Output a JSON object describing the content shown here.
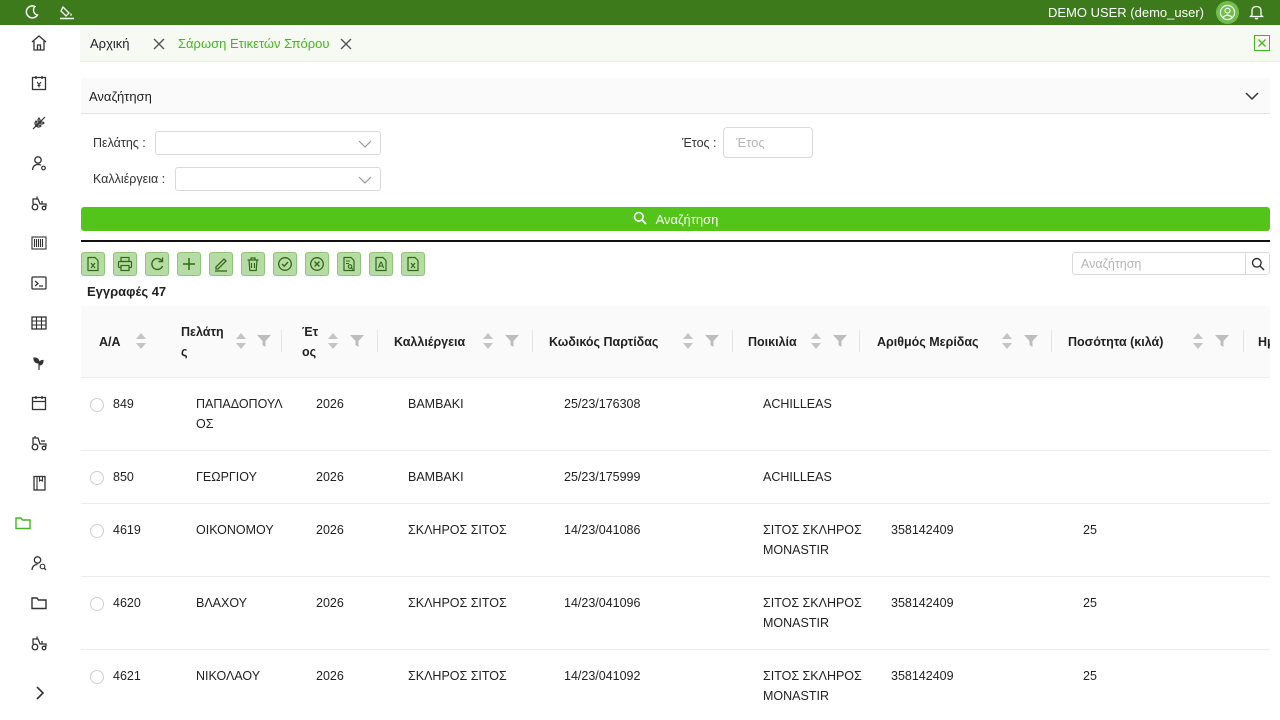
{
  "topbar": {
    "user_name": "DEMO USER (demo_user)"
  },
  "tabs": [
    {
      "label": "Αρχική"
    },
    {
      "label": "Σάρωση Ετικετών Σπόρου"
    }
  ],
  "search_panel": {
    "title": "Αναζήτηση",
    "customer_label": "Πελάτης :",
    "crop_label": "Καλλιέργεια :",
    "year_label": "Έτος :",
    "year_placeholder": "Έτος",
    "search_button": "Αναζήτηση"
  },
  "grid": {
    "search_placeholder": "Αναζήτηση",
    "records_label": "Εγγραφές 47",
    "columns": {
      "aa": "Α/Α",
      "customer_a": "Πελάτη",
      "customer_b": "ς",
      "year_a": "Έτ",
      "year_b": "ος",
      "crop": "Καλλιέργεια",
      "batch": "Κωδικός Παρτίδας",
      "variety": "Ποικιλία",
      "lot": "Αριθμός Μερίδας",
      "qty": "Ποσότητα (κιλά)",
      "next": "Ημ"
    },
    "rows": [
      {
        "aa": "849",
        "customer_a": "ΠΑΠΑΔΟΠΟΥΛ",
        "customer_b": "ΟΣ",
        "year": "2026",
        "crop": "ΒΑΜΒΑΚΙ",
        "batch": "25/23/176308",
        "variety_a": "ACHILLEAS",
        "variety_b": "",
        "lot": "",
        "qty": ""
      },
      {
        "aa": "850",
        "customer_a": "ΓΕΩΡΓΙΟΥ",
        "customer_b": "",
        "year": "2026",
        "crop": "ΒΑΜΒΑΚΙ",
        "batch": "25/23/175999",
        "variety_a": "ACHILLEAS",
        "variety_b": "",
        "lot": "",
        "qty": ""
      },
      {
        "aa": "4619",
        "customer_a": "ΟΙΚΟΝΟΜΟΥ",
        "customer_b": "",
        "year": "2026",
        "crop": "ΣΚΛΗΡΟΣ ΣΙΤΟΣ",
        "batch": "14/23/041086",
        "variety_a": "ΣΙΤΟΣ ΣΚΛΗΡΟΣ",
        "variety_b": "MONASTIR",
        "lot": "358142409",
        "qty": "25"
      },
      {
        "aa": "4620",
        "customer_a": "ΒΛΑΧΟΥ",
        "customer_b": "",
        "year": "2026",
        "crop": "ΣΚΛΗΡΟΣ ΣΙΤΟΣ",
        "batch": "14/23/041096",
        "variety_a": "ΣΙΤΟΣ ΣΚΛΗΡΟΣ",
        "variety_b": "MONASTIR",
        "lot": "358142409",
        "qty": "25"
      },
      {
        "aa": "4621",
        "customer_a": "ΝΙΚΟΛΑΟΥ",
        "customer_b": "",
        "year": "2026",
        "crop": "ΣΚΛΗΡΟΣ ΣΙΤΟΣ",
        "batch": "14/23/041092",
        "variety_a": "ΣΙΤΟΣ ΣΚΛΗΡΟΣ",
        "variety_b": "MONASTIR",
        "lot": "358142409",
        "qty": "25"
      }
    ]
  },
  "colors": {
    "topbar": "#3d7a1c",
    "accent": "#52c41a",
    "tool_button": "#b7dba5"
  }
}
